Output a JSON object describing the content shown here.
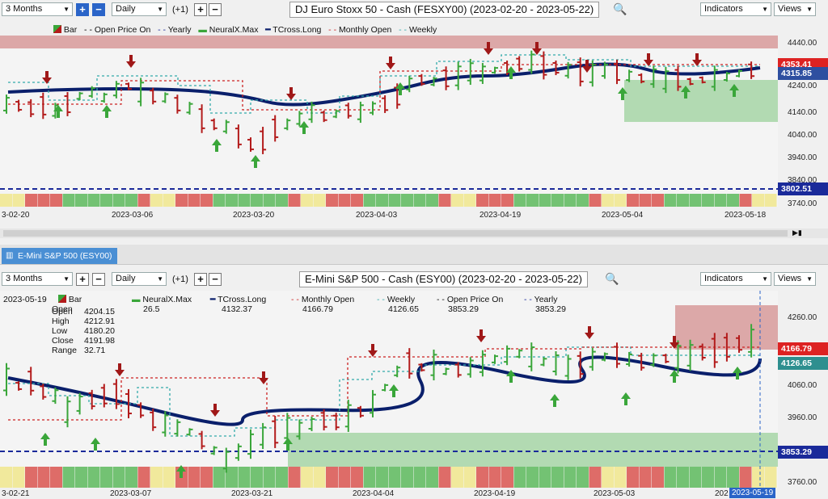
{
  "top": {
    "range": "3 Months",
    "interval": "Daily",
    "offset": "(+1)",
    "title": "DJ Euro Stoxx 50 - Cash (FESXY00) (2023-02-20 - 2023-05-22)",
    "indicators": "Indicators",
    "views": "Views",
    "legend": [
      "Bar",
      "Open Price On",
      "Yearly",
      "NeuralX.Max",
      "TCross.Long",
      "Monthly Open",
      "Weekly"
    ],
    "price_labels": [
      "4440.00",
      "4340.00",
      "4240.00",
      "4140.00",
      "4040.00",
      "3940.00",
      "3840.00",
      "3740.00"
    ],
    "tags": {
      "monthly": "4353.41",
      "tcross": "4315.85",
      "yearly": "3802.51"
    },
    "dates": [
      "3-02-20",
      "2023-03-06",
      "2023-03-20",
      "2023-04-03",
      "2023-04-19",
      "2023-05-04",
      "2023-05-18"
    ]
  },
  "tab": {
    "label": "E-Mini S&P 500 (ESY00)"
  },
  "bottom": {
    "range": "3 Months",
    "interval": "Daily",
    "offset": "(+1)",
    "title": "E-Mini S&P 500 - Cash (ESY00) (2023-02-20 - 2023-05-22)",
    "indicators": "Indicators",
    "views": "Views",
    "date_head": "2023-05-19",
    "bar_label": "Bar",
    "ohlc": [
      {
        "k": "Open",
        "v": "4204.15"
      },
      {
        "k": "High",
        "v": "4212.91"
      },
      {
        "k": "Low",
        "v": "4180.20"
      },
      {
        "k": "Close",
        "v": "4191.98"
      },
      {
        "k": "Range",
        "v": "32.71"
      }
    ],
    "legend": [
      {
        "name": "NeuralX.Max",
        "value": "26.5"
      },
      {
        "name": "TCross.Long",
        "value": "4132.37"
      },
      {
        "name": "Monthly Open",
        "value": "4166.79"
      },
      {
        "name": "Weekly",
        "value": "4126.65"
      },
      {
        "name": "Open Price On",
        "value": "3853.29"
      },
      {
        "name": "Yearly",
        "value": "3853.29"
      }
    ],
    "price_labels": [
      "4260.00",
      "4160.00",
      "4060.00",
      "3960.00",
      "3860.00",
      "3760.00"
    ],
    "tags": {
      "monthly": "4166.79",
      "weekly": "4126.65",
      "yearly": "3853.29"
    },
    "dates": [
      "3-02-21",
      "2023-03-07",
      "2023-03-21",
      "2023-04-04",
      "2023-04-19",
      "2023-05-03",
      "202",
      "2023-05-19"
    ]
  },
  "colors": {
    "up": "#3aa63a",
    "down": "#b31b1b",
    "tcross": "#0a1f6b",
    "yearly": "#1a2a9a",
    "accent": "#2a64c8"
  }
}
